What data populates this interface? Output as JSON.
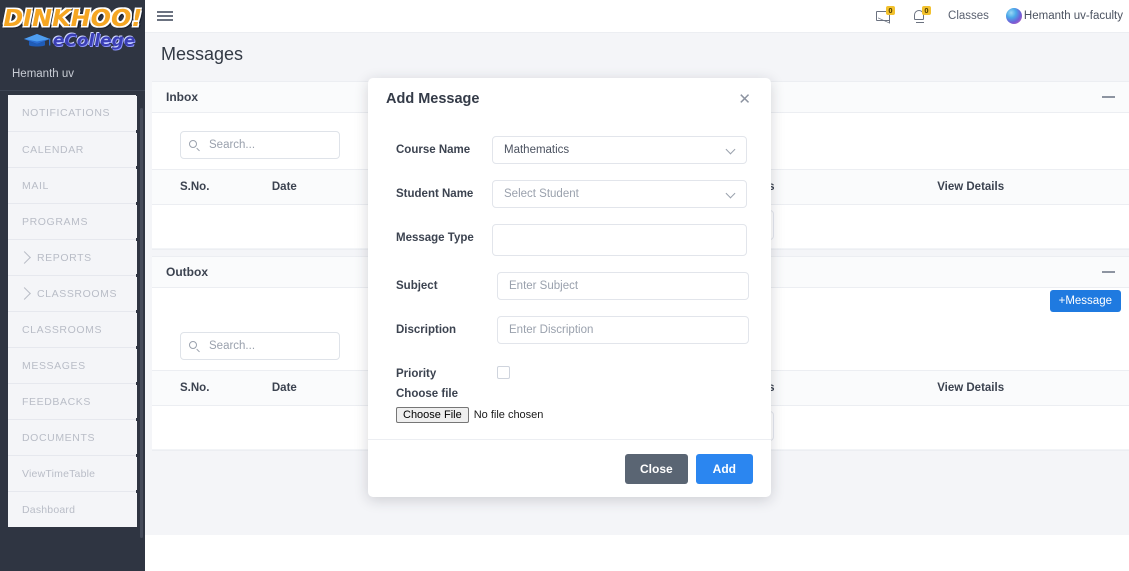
{
  "brand": {
    "logo_main": "DINKHOO!",
    "logo_sub": "eCollege",
    "cap_icon": "graduation-cap-icon",
    "user_name": "Hemanth uv"
  },
  "sidebar": {
    "items": [
      {
        "label": "NOTIFICATIONS",
        "expandable": false
      },
      {
        "label": "CALENDAR",
        "expandable": false
      },
      {
        "label": "MAIL",
        "expandable": false
      },
      {
        "label": "PROGRAMS",
        "expandable": false
      },
      {
        "label": "REPORTS",
        "expandable": true
      },
      {
        "label": "CLASSROOMS",
        "expandable": true
      },
      {
        "label": "CLASSROOMS",
        "expandable": false
      },
      {
        "label": "MESSAGES",
        "expandable": false
      },
      {
        "label": "FEEDBACKS",
        "expandable": false
      },
      {
        "label": "DOCUMENTS",
        "expandable": false
      },
      {
        "label": "ViewTimeTable",
        "expandable": false
      },
      {
        "label": "Dashboard",
        "expandable": false
      }
    ]
  },
  "topbar": {
    "menu_icon": "hamburger-icon",
    "mail_icon": "envelope-icon",
    "mail_count": "0",
    "bell_icon": "bell-icon",
    "bell_count": "0",
    "classes_label": "Classes",
    "avatar_icon": "avatar",
    "user_label": "Hemanth uv-faculty"
  },
  "page": {
    "title": "Messages"
  },
  "inbox": {
    "title": "Inbox",
    "collapse_icon": "minimize-icon",
    "search_placeholder": "Search...",
    "search_value": "",
    "search_icon": "search-icon",
    "columns": [
      "S.No.",
      "Date",
      "",
      "Status",
      "View Details"
    ],
    "rows": []
  },
  "outbox": {
    "title": "Outbox",
    "collapse_icon": "minimize-icon",
    "search_placeholder": "Search...",
    "search_value": "",
    "search_icon": "search-icon",
    "add_button": "+Message",
    "columns": [
      "S.No.",
      "Date",
      "",
      "Status",
      "View Details"
    ],
    "rows": []
  },
  "modal": {
    "title": "Add Message",
    "close_icon": "close-icon",
    "fields": {
      "course_label": "Course Name",
      "course_value": "Mathematics",
      "student_label": "Student Name",
      "student_placeholder": "Select Student",
      "msgtype_label": "Message Type",
      "msgtype_value": "",
      "subject_label": "Subject",
      "subject_placeholder": "Enter Subject",
      "subject_value": "",
      "discription_label": "Discription",
      "discription_placeholder": "Enter Discription",
      "discription_value": "",
      "priority_label": "Priority",
      "priority_checked": false,
      "file_label": "Choose file",
      "file_button": "Choose File",
      "file_status": "No file chosen"
    },
    "close_button": "Close",
    "add_button": "Add"
  },
  "colors": {
    "sidebar_bg": "#2f3542",
    "accent_blue": "#2b86f0",
    "close_gray": "#5a6573",
    "badge_yellow": "#f2c12e",
    "logo_orange": "#f5a623",
    "logo_purple": "#3b3fb5"
  }
}
